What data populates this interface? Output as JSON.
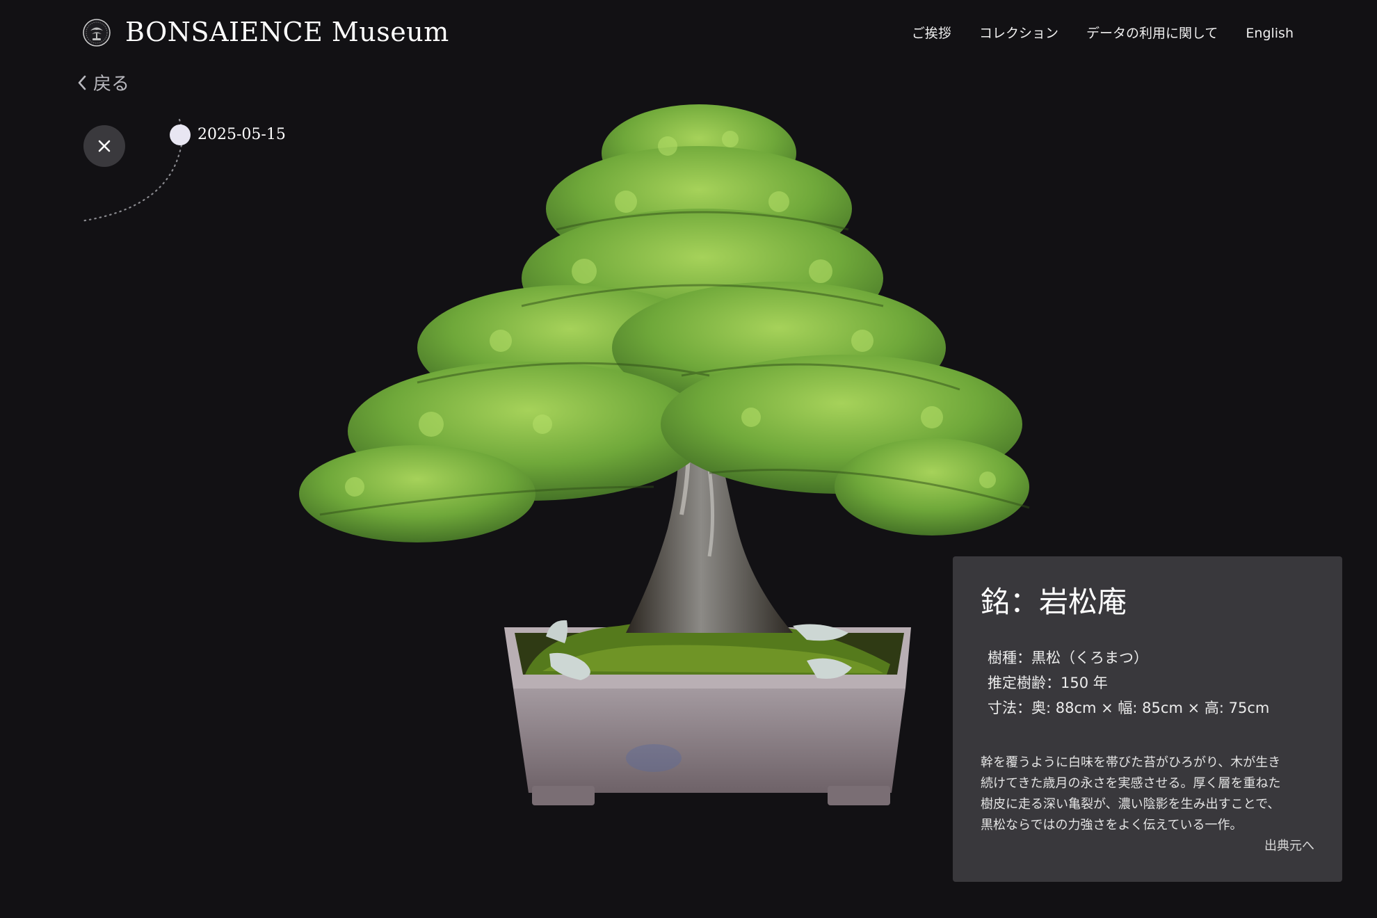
{
  "header": {
    "site_title": "BONSAIENCE Museum",
    "logo_icon": "bonsai-emblem-icon",
    "nav": [
      {
        "label": "ご挨拶"
      },
      {
        "label": "コレクション"
      },
      {
        "label": "データの利用に関して"
      },
      {
        "label": "English"
      }
    ]
  },
  "back": {
    "label": "戻る",
    "icon": "chevron-left-icon"
  },
  "close": {
    "icon": "close-icon"
  },
  "timeline": {
    "entries": [
      {
        "date": "2025-05-15"
      }
    ]
  },
  "card": {
    "title": "銘：岩松庵",
    "species": "樹種：黒松（くろまつ）",
    "age": "推定樹齢：150 年",
    "size": "寸法：奥: 88cm × 幅: 85cm × 高: 75cm",
    "description": "幹を覆うように白味を帯びた苔がひろがり、木が生き\n続けてきた歳月の永さを実感させる。厚く層を重ねた\n樹皮に走る深い亀裂が、濃い陰影を生み出すことで、\n黒松ならではの力強さをよく伝えている一作。",
    "source_link": "出典元へ"
  },
  "colors": {
    "background": "#121114",
    "card_background": "#39383c",
    "close_button": "#3a393d",
    "timeline_dot": "#e8e6f2",
    "foliage": "#7fb33f",
    "pot": "#8d7f86"
  }
}
